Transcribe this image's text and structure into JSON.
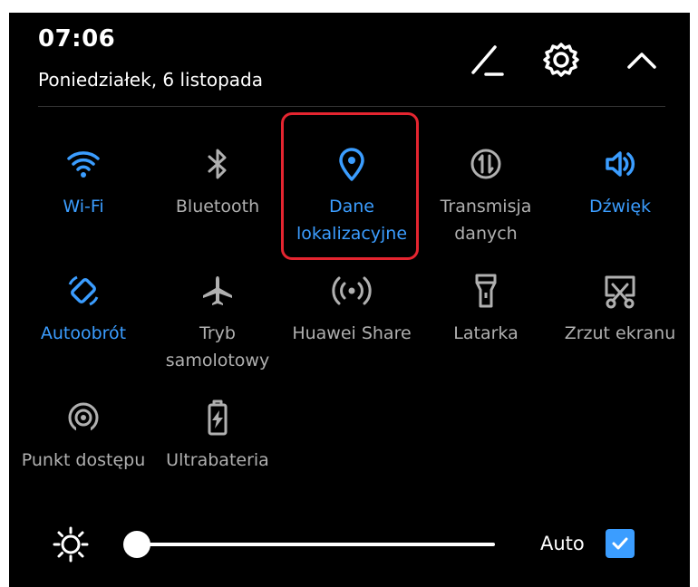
{
  "status": {
    "time": "07:06",
    "date": "Poniedziałek, 6 listopada"
  },
  "header_icons": [
    "edit-icon",
    "gear-icon",
    "chevron-up-icon"
  ],
  "tiles": [
    {
      "label_lines": [
        "Wi-Fi"
      ],
      "icon": "wifi-icon",
      "active": true
    },
    {
      "label_lines": [
        "Bluetooth"
      ],
      "icon": "bluetooth-icon",
      "active": false
    },
    {
      "label_lines": [
        "Dane",
        "lokalizacyjne"
      ],
      "icon": "location-pin-icon",
      "active": true,
      "highlighted": true
    },
    {
      "label_lines": [
        "Transmisja",
        "danych"
      ],
      "icon": "data-transfer-icon",
      "active": false
    },
    {
      "label_lines": [
        "Dźwięk"
      ],
      "icon": "speaker-icon",
      "active": true
    },
    {
      "label_lines": [
        "Autoobrót"
      ],
      "icon": "auto-rotate-icon",
      "active": true
    },
    {
      "label_lines": [
        "Tryb",
        "samolotowy"
      ],
      "icon": "airplane-icon",
      "active": false
    },
    {
      "label_lines": [
        "Huawei Share"
      ],
      "icon": "huawei-share-icon",
      "active": false
    },
    {
      "label_lines": [
        "Latarka"
      ],
      "icon": "flashlight-icon",
      "active": false
    },
    {
      "label_lines": [
        "Zrzut ekranu"
      ],
      "icon": "screenshot-icon",
      "active": false
    },
    {
      "label_lines": [
        "Punkt dostępu"
      ],
      "icon": "hotspot-icon",
      "active": false
    },
    {
      "label_lines": [
        "Ultrabateria"
      ],
      "icon": "battery-saver-icon",
      "active": false
    }
  ],
  "brightness": {
    "level": 0.0,
    "icon": "brightness-icon",
    "auto_label": "Auto",
    "auto_checked": true
  },
  "colors": {
    "accent": "#3b9dff",
    "inactive": "#b0b0b0",
    "highlight": "#e52530",
    "background": "#000000"
  }
}
